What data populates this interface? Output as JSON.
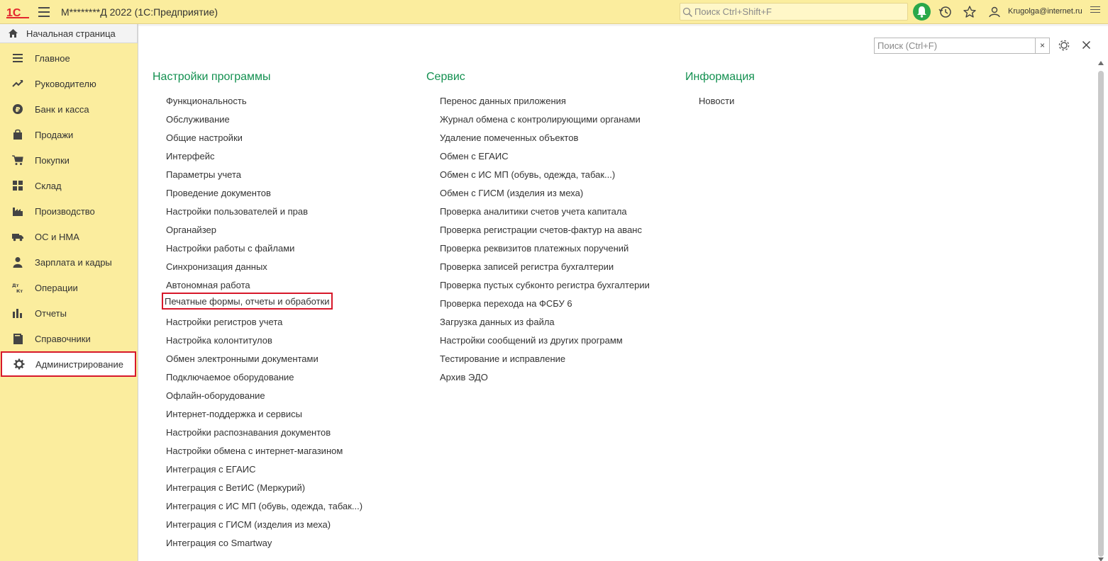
{
  "topbar": {
    "logo_text": "1С",
    "app_title": "М********Д 2022  (1С:Предприятие)",
    "search_placeholder": "Поиск Ctrl+Shift+F",
    "user_name": "Krugolga@internet.ru"
  },
  "colors": {
    "topbar_bg": "#fbed9e",
    "sidebar_bg": "#fbed9e",
    "section_title": "#139050",
    "highlight_frame": "#d7182a",
    "bell_bg": "#2aa84a",
    "logo_red": "#e3262d"
  },
  "home_tab": {
    "label": "Начальная страница",
    "icon": "home-icon"
  },
  "sidebar": {
    "items": [
      {
        "label": "Главное",
        "icon": "list-icon"
      },
      {
        "label": "Руководителю",
        "icon": "trend-up-icon"
      },
      {
        "label": "Банк и касса",
        "icon": "ruble-coin-icon"
      },
      {
        "label": "Продажи",
        "icon": "shopping-bag-icon"
      },
      {
        "label": "Покупки",
        "icon": "cart-icon"
      },
      {
        "label": "Склад",
        "icon": "warehouse-grid-icon"
      },
      {
        "label": "Производство",
        "icon": "factory-icon"
      },
      {
        "label": "ОС и НМА",
        "icon": "truck-icon"
      },
      {
        "label": "Зарплата и кадры",
        "icon": "person-icon"
      },
      {
        "label": "Операции",
        "icon": "debit-credit-icon"
      },
      {
        "label": "Отчеты",
        "icon": "bar-chart-icon"
      },
      {
        "label": "Справочники",
        "icon": "book-icon"
      },
      {
        "label": "Администрирование",
        "icon": "gear-icon",
        "active": true
      }
    ]
  },
  "form": {
    "search_placeholder": "Поиск (Ctrl+F)",
    "clear_label": "×"
  },
  "columns": {
    "settings": {
      "title": "Настройки программы",
      "links": [
        "Функциональность",
        "Обслуживание",
        "Общие настройки",
        "Интерфейс",
        "Параметры учета",
        "Проведение документов",
        "Настройки пользователей и прав",
        "Органайзер",
        "Настройки работы с файлами",
        "Синхронизация данных",
        "Автономная работа",
        "Печатные формы, отчеты и обработки",
        "Настройки регистров учета",
        "Настройка колонтитулов",
        "Обмен электронными документами",
        "Подключаемое оборудование",
        "Офлайн-оборудование",
        "Интернет-поддержка и сервисы",
        "Настройки распознавания документов",
        "Настройки обмена с интернет-магазином",
        "Интеграция с ЕГАИС",
        "Интеграция с ВетИС (Меркурий)",
        "Интеграция с ИС МП (обувь, одежда, табак...)",
        "Интеграция с ГИСМ (изделия из меха)",
        "Интеграция со Smartway"
      ]
    },
    "service": {
      "title": "Сервис",
      "links": [
        "Перенос данных приложения",
        "Журнал обмена с контролирующими органами",
        "Удаление помеченных объектов",
        "Обмен с ЕГАИС",
        "Обмен с ИС МП (обувь, одежда, табак...)",
        "Обмен с ГИСМ (изделия из меха)",
        "Проверка аналитики счетов учета капитала",
        "Проверка регистрации счетов-фактур на аванс",
        "Проверка реквизитов платежных поручений",
        "Проверка записей регистра бухгалтерии",
        "Проверка пустых субконто регистра бухгалтерии",
        "Проверка перехода на ФСБУ 6",
        "Загрузка данных из файла",
        "Настройки сообщений из других программ",
        "Тестирование и исправление",
        "Архив ЭДО"
      ]
    },
    "info": {
      "title": "Информация",
      "links": [
        "Новости"
      ]
    }
  }
}
